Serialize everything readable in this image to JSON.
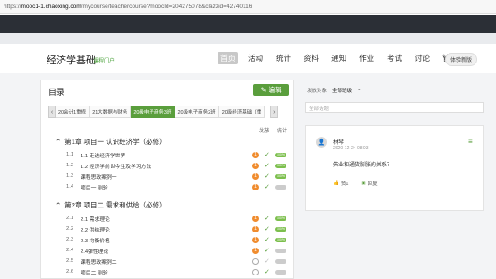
{
  "browser": {
    "url_prefix": "https://",
    "url_host": "mooc1-1.chaoxing.com",
    "url_path": "/mycourse/teachercourse?moocId=204275078&clazzid=42740116"
  },
  "header": {
    "course_title": "经济学基础",
    "course_sub": "课程门户",
    "nav": [
      "首页",
      "活动",
      "统计",
      "资料",
      "通知",
      "作业",
      "考试",
      "讨论",
      "管理"
    ],
    "active_nav": "首页",
    "experience_button": "体验新版"
  },
  "catalog": {
    "title": "目录",
    "edit_label": "编辑",
    "tabs": [
      "20会计1重修",
      "21大数据与财务",
      "20级电子商务3班",
      "20级电子商务2班",
      "20级经济基础（重"
    ],
    "active_tab": "20级电子商务3班",
    "col_headers": [
      "发放",
      "统计"
    ],
    "chapters": [
      {
        "label": "第1章 项目一 认识经济学（必修）",
        "rows": [
          {
            "num": "1.1",
            "title": "1.1 走进经济学世界",
            "badge": "1",
            "check": true,
            "pill": "100%"
          },
          {
            "num": "1.2",
            "title": "1.2 经济学前世今生及学习方法",
            "badge": "1",
            "check": true,
            "pill": "100%"
          },
          {
            "num": "1.3",
            "title": "课程思政案例一",
            "badge": "1",
            "check": true,
            "pill": "100%"
          },
          {
            "num": "1.4",
            "title": "项目一 测验",
            "badge": "1",
            "check": true,
            "pill": ""
          }
        ]
      },
      {
        "label": "第2章 项目二 需求和供给（必修）",
        "rows": [
          {
            "num": "2.1",
            "title": "2.1 需求理论",
            "badge": "1",
            "check": true,
            "pill": "100%"
          },
          {
            "num": "2.2",
            "title": "2.2 供给理论",
            "badge": "1",
            "check": true,
            "pill": "100%"
          },
          {
            "num": "2.3",
            "title": "2.3 均衡价格",
            "badge": "1",
            "check": true,
            "pill": "100%"
          },
          {
            "num": "2.4",
            "title": "2.4弹性理论",
            "badge": "1",
            "check": true,
            "pill": ""
          },
          {
            "num": "2.5",
            "title": "课程思政案例二",
            "badge": "",
            "check": false,
            "pill": ""
          },
          {
            "num": "2.6",
            "title": "项目二 测验",
            "badge": "",
            "check": true,
            "pill": ""
          }
        ]
      }
    ]
  },
  "discussion": {
    "target_label": "发放对象",
    "target_value": "全部班级",
    "search_placeholder": "全部话题",
    "post": {
      "author": "林琴",
      "date": "2020-12-24 08:03",
      "question": "失业和通货膨胀的关系？",
      "likes": "赞1",
      "reply": "回复"
    }
  },
  "colors": {
    "accent": "#5a9e3c",
    "badge": "#f08c2e"
  }
}
